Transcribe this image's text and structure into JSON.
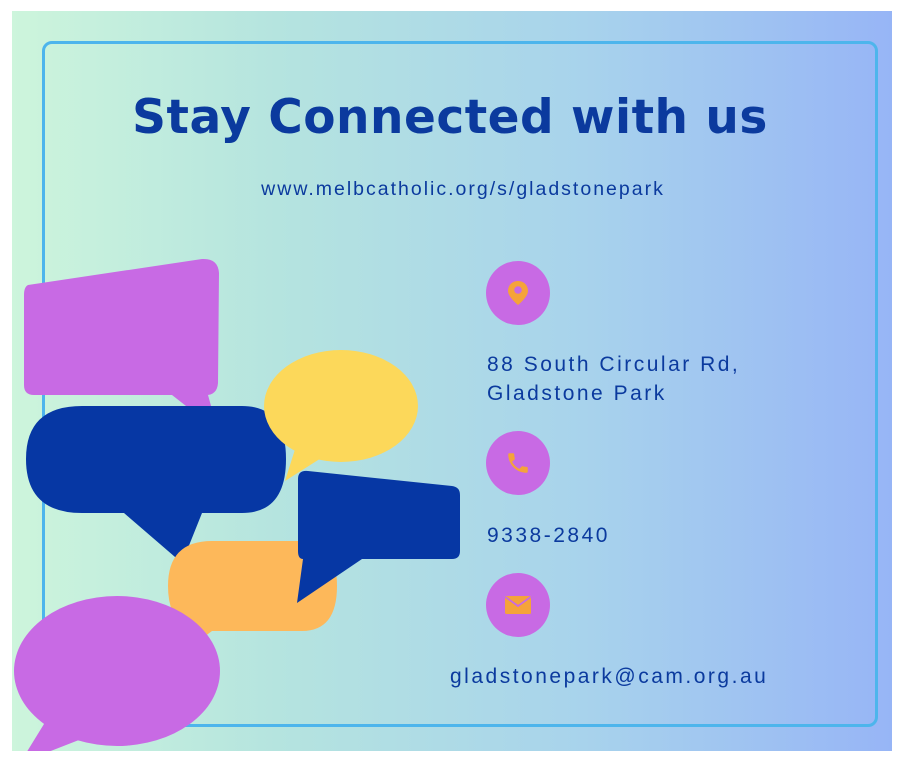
{
  "heading": "Stay Connected with us",
  "website": "www.melbcatholic.org/s/gladstonepark",
  "contacts": {
    "address_line1": "88 South Circular Rd,",
    "address_line2": "Gladstone Park",
    "phone": "9338-2840",
    "email": "gladstonepark@cam.org.au"
  },
  "icons": {
    "address": "location-pin-icon",
    "phone": "phone-icon",
    "email": "envelope-icon"
  },
  "colors": {
    "text": "#0b3a9e",
    "icon_bg": "#c86ae4",
    "icon_fg": "#f5a33a",
    "bubble_purple": "#c86ae4",
    "bubble_navy": "#0637a4",
    "bubble_yellow": "#fcd85a",
    "bubble_orange": "#fdb85a",
    "frame": "#4db5ec"
  }
}
